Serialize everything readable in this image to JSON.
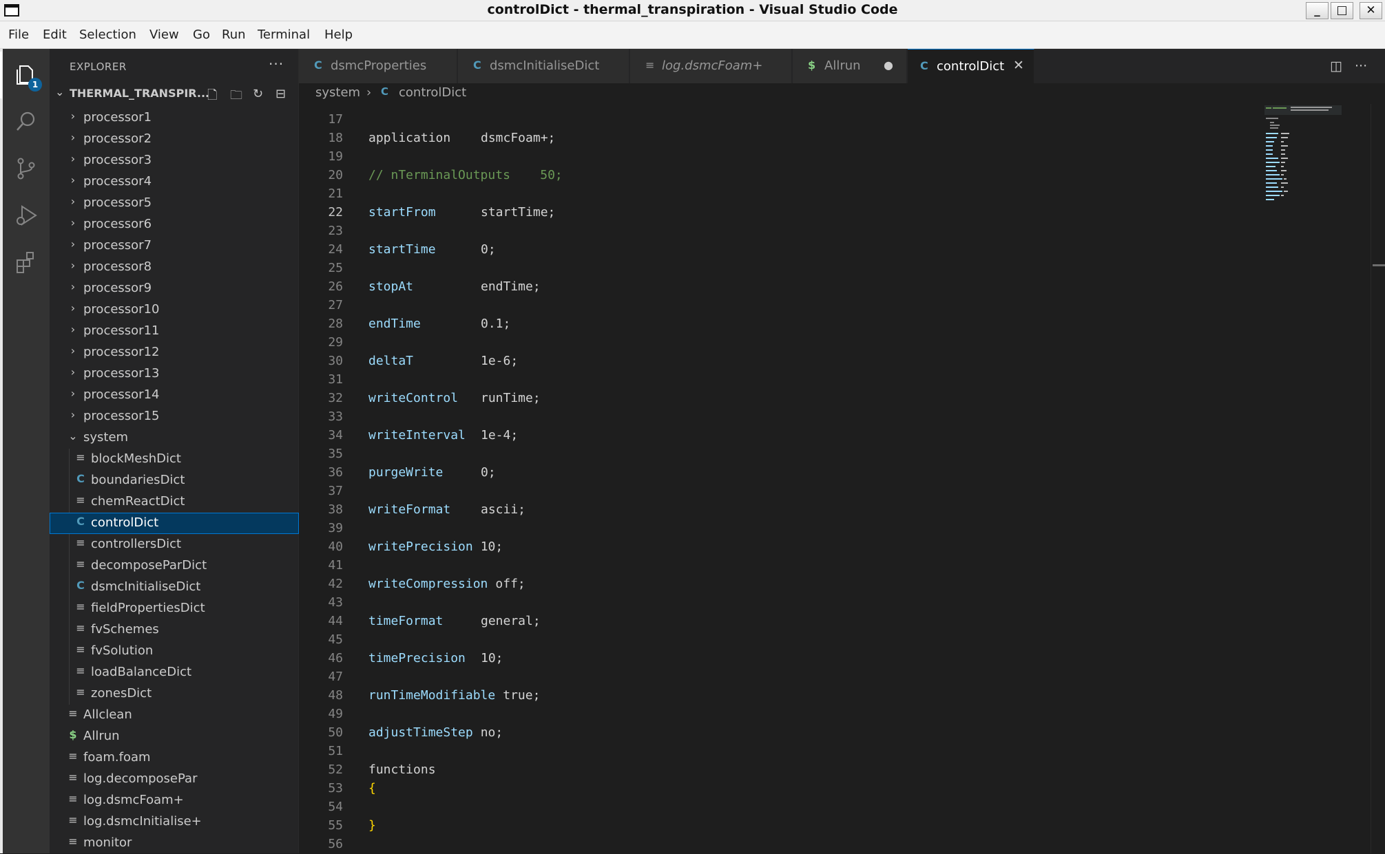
{
  "window": {
    "title": "controlDict - thermal_transpiration - Visual Studio Code",
    "controls": {
      "minimize": "_",
      "maximize": "□",
      "close": "✕"
    }
  },
  "menu": [
    "File",
    "Edit",
    "Selection",
    "View",
    "Go",
    "Run",
    "Terminal",
    "Help"
  ],
  "activity": {
    "items": [
      "files-icon",
      "search-icon",
      "source-control-icon",
      "run-debug-icon",
      "extensions-icon"
    ],
    "explorer_badge": "1"
  },
  "sidebar": {
    "title": "EXPLORER",
    "more": "···",
    "section_label": "THERMAL_TRANSPIR...",
    "tree": [
      {
        "label": "processor1"
      },
      {
        "label": "processor2"
      },
      {
        "label": "processor3"
      },
      {
        "label": "processor4"
      },
      {
        "label": "processor5"
      },
      {
        "label": "processor6"
      },
      {
        "label": "processor7"
      },
      {
        "label": "processor8"
      },
      {
        "label": "processor9"
      },
      {
        "label": "processor10"
      },
      {
        "label": "processor11"
      },
      {
        "label": "processor12"
      },
      {
        "label": "processor13"
      },
      {
        "label": "processor14"
      },
      {
        "label": "processor15"
      },
      {
        "label": "system"
      },
      {
        "label": "blockMeshDict"
      },
      {
        "label": "boundariesDict"
      },
      {
        "label": "chemReactDict"
      },
      {
        "label": "controlDict"
      },
      {
        "label": "controllersDict"
      },
      {
        "label": "decomposeParDict"
      },
      {
        "label": "dsmcInitialiseDict"
      },
      {
        "label": "fieldPropertiesDict"
      },
      {
        "label": "fvSchemes"
      },
      {
        "label": "fvSolution"
      },
      {
        "label": "loadBalanceDict"
      },
      {
        "label": "zonesDict"
      },
      {
        "label": "Allclean"
      },
      {
        "label": "Allrun"
      },
      {
        "label": "foam.foam"
      },
      {
        "label": "log.decomposePar"
      },
      {
        "label": "log.dsmcFoam+"
      },
      {
        "label": "log.dsmcInitialise+"
      },
      {
        "label": "monitor"
      }
    ]
  },
  "tabs": [
    {
      "label": "dsmcProperties",
      "icon": "C"
    },
    {
      "label": "dsmcInitialiseDict",
      "icon": "C"
    },
    {
      "label": "log.dsmcFoam+",
      "icon": "≡"
    },
    {
      "label": "Allrun",
      "icon": "$",
      "dirty": "●"
    },
    {
      "label": "controlDict",
      "icon": "C",
      "close": "✕"
    }
  ],
  "breadcrumb": {
    "folder": "system",
    "sep": "›",
    "file": "controlDict"
  },
  "editor": {
    "current_line": "22",
    "lines": [
      {
        "n": "17",
        "key": "",
        "val": ""
      },
      {
        "n": "18",
        "key": "application",
        "val": "dsmcFoam+;"
      },
      {
        "n": "19",
        "key": "",
        "val": ""
      },
      {
        "n": "20",
        "comment": "// nTerminalOutputs    50;"
      },
      {
        "n": "21",
        "key": "",
        "val": ""
      },
      {
        "n": "22",
        "key": "startFrom",
        "val": "startTime;"
      },
      {
        "n": "23",
        "key": "",
        "val": ""
      },
      {
        "n": "24",
        "key": "startTime",
        "val": "0;"
      },
      {
        "n": "25",
        "key": "",
        "val": ""
      },
      {
        "n": "26",
        "key": "stopAt",
        "val": "endTime;"
      },
      {
        "n": "27",
        "key": "",
        "val": ""
      },
      {
        "n": "28",
        "key": "endTime",
        "val": "0.1;"
      },
      {
        "n": "29",
        "key": "",
        "val": ""
      },
      {
        "n": "30",
        "key": "deltaT",
        "val": "1e-6;"
      },
      {
        "n": "31",
        "key": "",
        "val": ""
      },
      {
        "n": "32",
        "key": "writeControl",
        "val": "runTime;"
      },
      {
        "n": "33",
        "key": "",
        "val": ""
      },
      {
        "n": "34",
        "key": "writeInterval",
        "val": "1e-4;"
      },
      {
        "n": "35",
        "key": "",
        "val": ""
      },
      {
        "n": "36",
        "key": "purgeWrite",
        "val": "0;"
      },
      {
        "n": "37",
        "key": "",
        "val": ""
      },
      {
        "n": "38",
        "key": "writeFormat",
        "val": "ascii;"
      },
      {
        "n": "39",
        "key": "",
        "val": ""
      },
      {
        "n": "40",
        "key": "writePrecision",
        "val": "10;"
      },
      {
        "n": "41",
        "key": "",
        "val": ""
      },
      {
        "n": "42",
        "key": "writeCompression",
        "val": "off;"
      },
      {
        "n": "43",
        "key": "",
        "val": ""
      },
      {
        "n": "44",
        "key": "timeFormat",
        "val": "general;"
      },
      {
        "n": "45",
        "key": "",
        "val": ""
      },
      {
        "n": "46",
        "key": "timePrecision",
        "val": "10;"
      },
      {
        "n": "47",
        "key": "",
        "val": ""
      },
      {
        "n": "48",
        "key": "runTimeModifiable",
        "val": "true;"
      },
      {
        "n": "49",
        "key": "",
        "val": ""
      },
      {
        "n": "50",
        "key": "adjustTimeStep",
        "val": "no;"
      },
      {
        "n": "51",
        "key": "",
        "val": ""
      },
      {
        "n": "52",
        "plain": "functions"
      },
      {
        "n": "53",
        "brace": "{"
      },
      {
        "n": "54",
        "key": "",
        "val": ""
      },
      {
        "n": "55",
        "brace": "}"
      },
      {
        "n": "56",
        "key": "",
        "val": ""
      }
    ]
  },
  "colors": {
    "accent": "#0078d4",
    "selection": "#04395e",
    "editor_bg": "#1e1e1e",
    "sidebar_bg": "#252526",
    "activity_bg": "#333333"
  }
}
